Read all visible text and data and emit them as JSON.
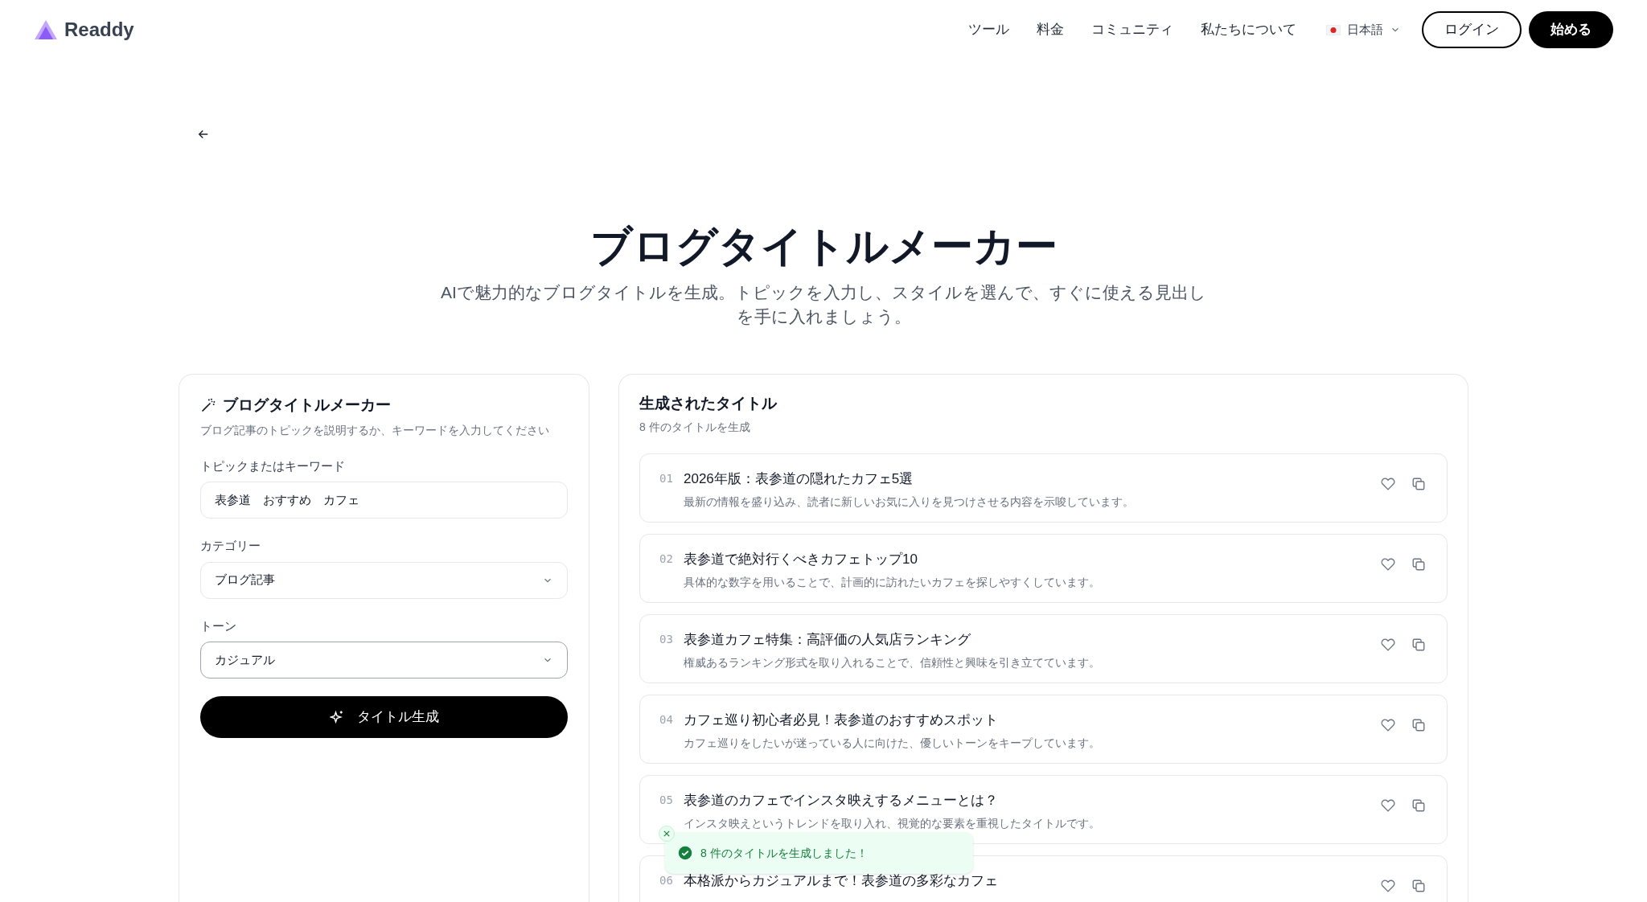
{
  "header": {
    "logo": "Readdy",
    "nav": [
      "ツール",
      "料金",
      "コミュニティ",
      "私たちについて"
    ],
    "language": "日本語",
    "login": "ログイン",
    "start": "始める"
  },
  "hero": {
    "title": "ブログタイトルメーカー",
    "subtitle": "AIで魅力的なブログタイトルを生成。トピックを入力し、スタイルを選んで、すぐに使える見出しを手に入れましょう。"
  },
  "form": {
    "title": "ブログタイトルメーカー",
    "description": "ブログ記事のトピックを説明するか、キーワードを入力してください",
    "fields": [
      {
        "kind": "text",
        "label": "トピックまたはキーワード",
        "value": "表参道　おすすめ　カフェ",
        "focused": false
      },
      {
        "kind": "select",
        "label": "カテゴリー",
        "value": "ブログ記事",
        "focused": false
      },
      {
        "kind": "select",
        "label": "トーン",
        "value": "カジュアル",
        "focused": true
      }
    ],
    "button": "タイトル生成"
  },
  "results": {
    "title": "生成されたタイトル",
    "count": "8 件のタイトルを生成",
    "items": [
      {
        "number": "01",
        "title": "2026年版：表参道の隠れたカフェ5選",
        "description": "最新の情報を盛り込み、読者に新しいお気に入りを見つけさせる内容を示唆しています。"
      },
      {
        "number": "02",
        "title": "表参道で絶対行くべきカフェトップ10",
        "description": "具体的な数字を用いることで、計画的に訪れたいカフェを探しやすくしています。"
      },
      {
        "number": "03",
        "title": "表参道カフェ特集：高評価の人気店ランキング",
        "description": "権威あるランキング形式を取り入れることで、信頼性と興味を引き立てています。"
      },
      {
        "number": "04",
        "title": "カフェ巡り初心者必見！表参道のおすすめスポット",
        "description": "カフェ巡りをしたいが迷っている人に向けた、優しいトーンをキープしています。"
      },
      {
        "number": "05",
        "title": "表参道のカフェでインスタ映えするメニューとは？",
        "description": "インスタ映えというトレンドを取り入れ、視覚的な要素を重視したタイトルです。"
      },
      {
        "number": "06",
        "title": "本格派からカジュアルまで！表参道の多彩なカフェ"
      }
    ]
  },
  "toast": {
    "message": "8 件のタイトルを生成しました！"
  }
}
